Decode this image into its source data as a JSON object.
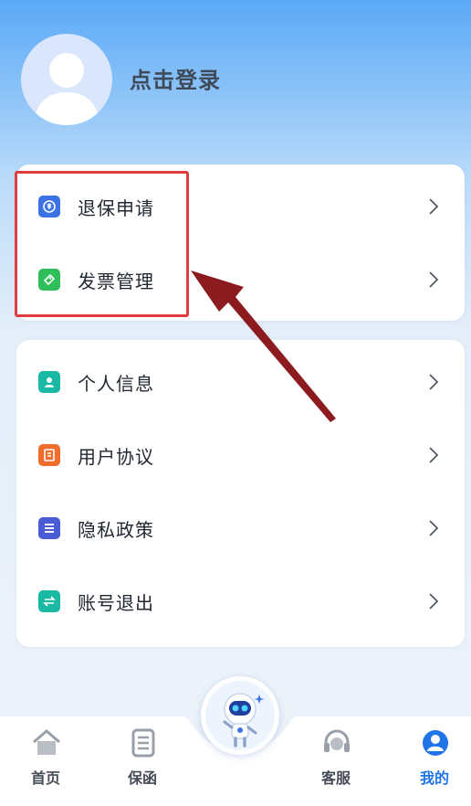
{
  "header": {
    "login_text": "点击登录"
  },
  "card_main": {
    "items": [
      {
        "label": "退保申请",
        "icon": "refund-icon",
        "color": "#3d72e6"
      },
      {
        "label": "发票管理",
        "icon": "invoice-icon",
        "color": "#2ebf5a"
      }
    ]
  },
  "card_settings": {
    "items": [
      {
        "label": "个人信息",
        "icon": "person-icon",
        "color": "#19b9a3"
      },
      {
        "label": "用户协议",
        "icon": "agreement-icon",
        "color": "#f06d2b"
      },
      {
        "label": "隐私政策",
        "icon": "privacy-icon",
        "color": "#4a5bd6"
      },
      {
        "label": "账号退出",
        "icon": "logout-icon",
        "color": "#19b9a3"
      }
    ]
  },
  "tabbar": {
    "tabs": [
      {
        "label": "首页",
        "icon": "home-icon"
      },
      {
        "label": "保函",
        "icon": "document-icon"
      },
      {
        "label": "客服",
        "icon": "headset-icon"
      },
      {
        "label": "我的",
        "icon": "profile-icon",
        "active": true
      }
    ],
    "center_button": {
      "icon": "robot-icon"
    }
  },
  "annotation": {
    "highlight_color": "#e03b3f",
    "arrow_color": "#8b1b1f"
  }
}
